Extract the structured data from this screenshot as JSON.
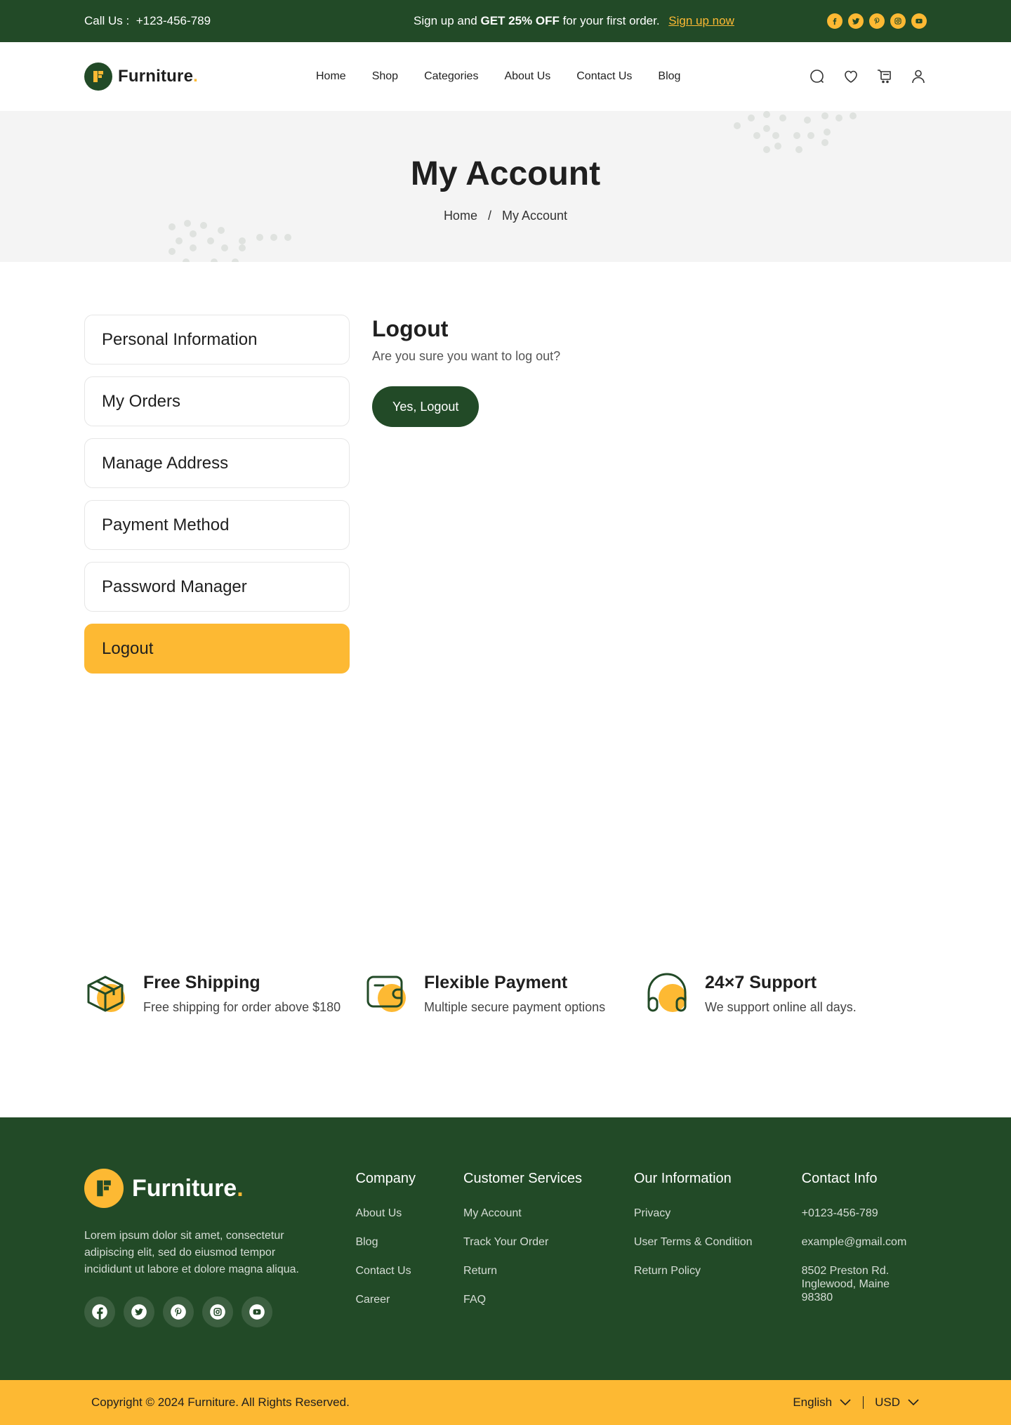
{
  "topbar": {
    "call_label": "Call Us :",
    "phone": "+123-456-789",
    "promo_prefix": "Sign up and ",
    "promo_bold": "GET 25% OFF",
    "promo_suffix": " for your first order.",
    "promo_link": "Sign up now",
    "social_icons": [
      "facebook-icon",
      "twitter-icon",
      "pinterest-icon",
      "instagram-icon",
      "youtube-icon"
    ]
  },
  "header": {
    "brand": "Furniture",
    "brand_dot": ".",
    "nav": [
      "Home",
      "Shop",
      "Categories",
      "About Us",
      "Contact Us",
      "Blog"
    ],
    "icons": [
      "search-icon",
      "heart-icon",
      "cart-icon",
      "user-icon"
    ]
  },
  "hero": {
    "title": "My Account",
    "breadcrumb": [
      "Home",
      "My Account"
    ],
    "separator": "/"
  },
  "sidebar": {
    "items": [
      {
        "label": "Personal Information",
        "active": false
      },
      {
        "label": "My Orders",
        "active": false
      },
      {
        "label": "Manage Address",
        "active": false
      },
      {
        "label": "Payment Method",
        "active": false
      },
      {
        "label": "Password Manager",
        "active": false
      },
      {
        "label": "Logout",
        "active": true
      }
    ]
  },
  "content": {
    "title": "Logout",
    "question": "Are you sure you want to log out?",
    "confirm_button": "Yes, Logout"
  },
  "features": [
    {
      "icon": "box-icon",
      "title": "Free Shipping",
      "desc": "Free shipping for order above $180"
    },
    {
      "icon": "wallet-icon",
      "title": "Flexible Payment",
      "desc": "Multiple secure payment options"
    },
    {
      "icon": "headphones-icon",
      "title": "24×7 Support",
      "desc": "We support online all days."
    }
  ],
  "footer": {
    "brand": "Furniture",
    "brand_dot": ".",
    "description": "Lorem ipsum dolor sit amet, consectetur adipiscing elit, sed do eiusmod tempor incididunt ut labore et dolore magna aliqua.",
    "columns": {
      "company": {
        "title": "Company",
        "links": [
          "About Us",
          "Blog",
          "Contact Us",
          "Career"
        ]
      },
      "services": {
        "title": "Customer Services",
        "links": [
          "My Account",
          "Track Your Order",
          "Return",
          "FAQ"
        ]
      },
      "info": {
        "title": "Our Information",
        "links": [
          "Privacy",
          "User Terms & Condition",
          "Return Policy"
        ]
      },
      "contact": {
        "title": "Contact Info",
        "phone": "+0123-456-789",
        "email": "example@gmail.com",
        "address": [
          "8502 Preston Rd.",
          "Inglewood, Maine",
          "98380"
        ]
      }
    }
  },
  "bottombar": {
    "copyright": "Copyright © 2024 Furniture. All Rights Reserved.",
    "language": "English",
    "currency": "USD"
  },
  "colors": {
    "primary_green": "#224a27",
    "accent_yellow": "#fdb933",
    "hero_bg": "#f4f4f4"
  }
}
